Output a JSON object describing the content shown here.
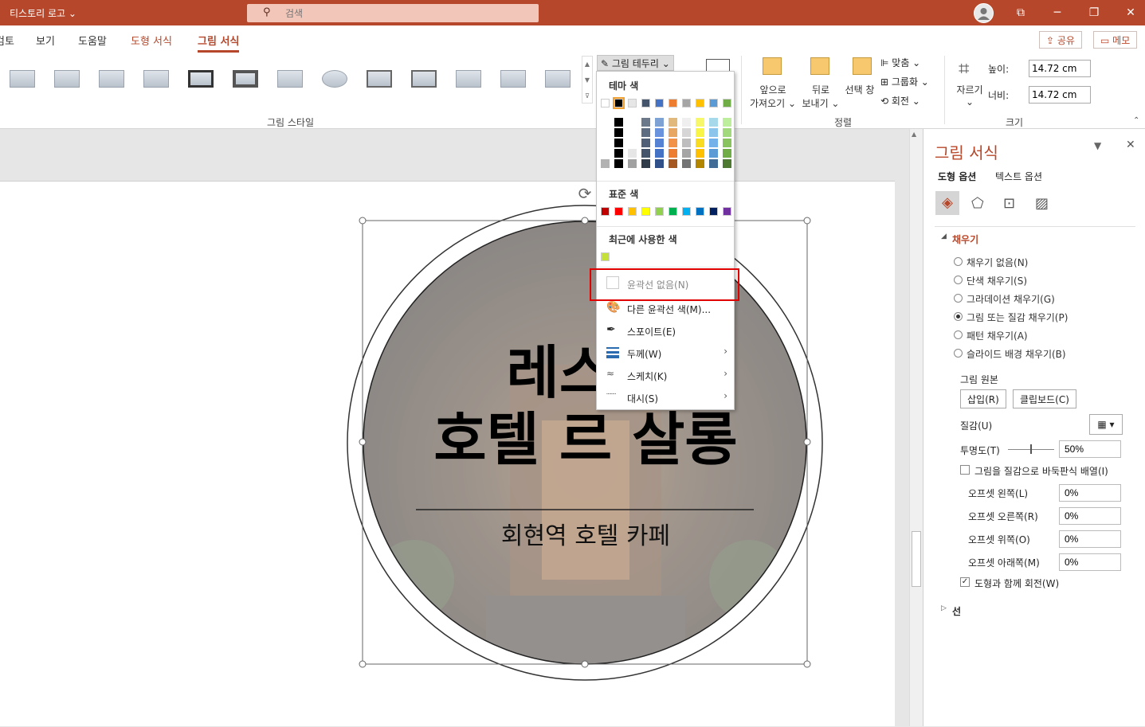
{
  "titlebar": {
    "app_title": "티스토리 로고 ⌄",
    "search_placeholder": "검색"
  },
  "menu": {
    "tabs": [
      "검토",
      "보기",
      "도움말",
      "도형 서식",
      "그림 서식"
    ],
    "share": "공유",
    "memo": "메모"
  },
  "ribbon": {
    "picture_styles_label": "그림 스타일",
    "border_button": "그림 테두리 ⌄",
    "arrange_label": "정렬",
    "bring_forward": "앞으로",
    "bring_forward2": "가져오기 ⌄",
    "send_backward": "뒤로",
    "send_backward2": "보내기 ⌄",
    "selection_pane": "선택 창",
    "align": "맞춤 ⌄",
    "group": "그룹화 ⌄",
    "rotate": "회전 ⌄",
    "crop": "자르기",
    "height_label": "높이:",
    "height_value": "14.72 cm",
    "width_label": "너비:",
    "width_value": "14.72 cm",
    "size_label": "크기"
  },
  "slide": {
    "title_line1": "레스카",
    "title_line2": "호텔 르 살롱",
    "subtitle": "회현역 호텔 카페"
  },
  "dropdown": {
    "theme_colors_label": "테마 색",
    "standard_colors_label": "표준 색",
    "recent_colors_label": "최근에 사용한 색",
    "theme_top": [
      "#ffffff",
      "#000000",
      "#e7e6e6",
      "#44546a",
      "#4472c4",
      "#ed7d31",
      "#a5a5a5",
      "#ffc000",
      "#5b9bd5",
      "#70ad47"
    ],
    "standard": [
      "#c00000",
      "#ff0000",
      "#ffc000",
      "#ffff00",
      "#92d050",
      "#00b050",
      "#00b0f0",
      "#0070c0",
      "#002060",
      "#7030a0"
    ],
    "recent": [
      "#c6e03a"
    ],
    "items": [
      {
        "label": "윤곽선 없음(N)",
        "icon": "no-outline-icon"
      },
      {
        "label": "다른 윤곽선 색(M)...",
        "icon": "palette-icon"
      },
      {
        "label": "스포이트(E)",
        "icon": "eyedropper-icon"
      },
      {
        "label": "두께(W)",
        "icon": "weight-icon",
        "submenu": true
      },
      {
        "label": "스케치(K)",
        "icon": "sketch-icon",
        "submenu": true
      },
      {
        "label": "대시(S)",
        "icon": "dash-icon",
        "submenu": true
      }
    ]
  },
  "pane": {
    "title": "그림 서식",
    "tab_shape": "도형 옵션",
    "tab_text": "텍스트 옵션",
    "fill_section": "채우기",
    "fill_options": [
      "채우기 없음(N)",
      "단색 채우기(S)",
      "그라데이션 채우기(G)",
      "그림 또는 질감 채우기(P)",
      "패턴 채우기(A)",
      "슬라이드 배경 채우기(B)"
    ],
    "fill_selected_index": 3,
    "picture_source": "그림 원본",
    "insert_btn": "삽입(R)",
    "clipboard_btn": "클립보드(C)",
    "texture_label": "질감(U)",
    "transparency_label": "투명도(T)",
    "transparency_value": "50%",
    "tile_label": "그림을 질감으로 바둑판식 배열(I)",
    "offset_left_label": "오프셋 왼쪽(L)",
    "offset_right_label": "오프셋 오른쪽(R)",
    "offset_top_label": "오프셋 위쪽(O)",
    "offset_bottom_label": "오프셋 아래쪽(M)",
    "offset_value": "0%",
    "rotate_with_shape": "도형과 함께 회전(W)",
    "line_section": "선"
  }
}
